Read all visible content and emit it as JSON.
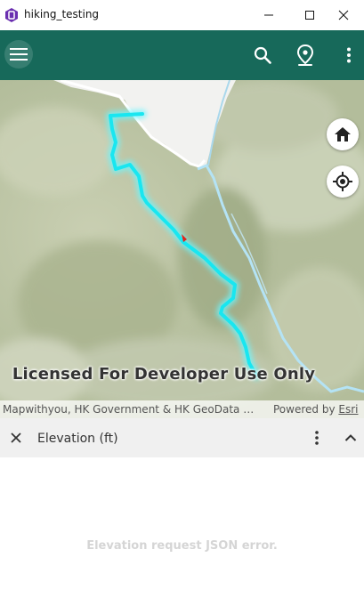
{
  "window": {
    "title": "hiking_testing",
    "controls": [
      "minimize",
      "maximize",
      "close"
    ]
  },
  "toolbar": {
    "color": "#17695a",
    "icons": [
      "menu-icon",
      "search-icon",
      "location-pin-icon",
      "more-vert-icon"
    ]
  },
  "map": {
    "watermark": "Licensed For Developer Use Only",
    "attribution": "Mapwithyou, HK Government & HK GeoData …",
    "powered_by": "Powered by",
    "powered_by_link": "Esri",
    "route_color": "#19e6f0",
    "buttons": [
      "home-icon",
      "my-location-icon"
    ]
  },
  "elevation_panel": {
    "title": "Elevation (ft)",
    "error_message": "Elevation request JSON error."
  }
}
